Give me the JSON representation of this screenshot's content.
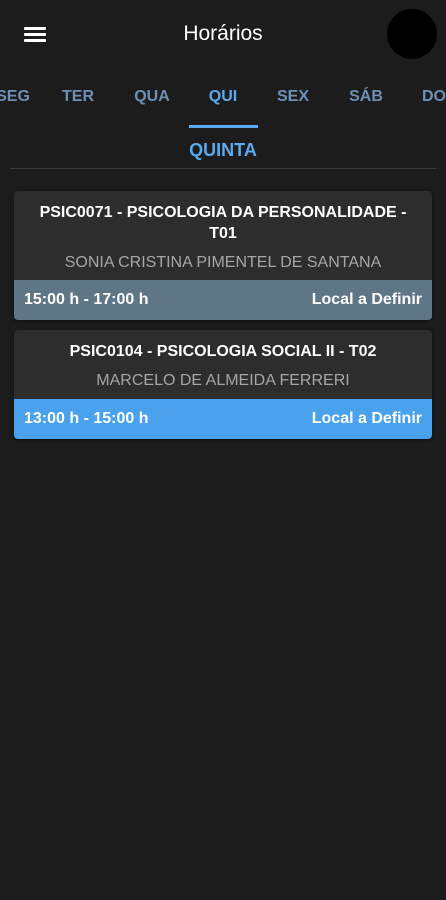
{
  "header": {
    "title": "Horários",
    "menu_icon": "hamburger-menu-icon"
  },
  "tabs": [
    {
      "label": "SEG",
      "active": false
    },
    {
      "label": "TER",
      "active": false
    },
    {
      "label": "QUA",
      "active": false
    },
    {
      "label": "QUI",
      "active": true
    },
    {
      "label": "SEX",
      "active": false
    },
    {
      "label": "SÁB",
      "active": false
    },
    {
      "label": "DOM",
      "active": false
    }
  ],
  "day_title": "QUINTA",
  "classes": [
    {
      "title": "PSIC0071 - PSICOLOGIA DA PERSONALIDADE - T01",
      "professor": "SONIA CRISTINA PIMENTEL DE SANTANA",
      "time": "15:00 h - 17:00 h",
      "location": "Local a Definir",
      "footer_color": "#5f7687"
    },
    {
      "title": "PSIC0104 - PSICOLOGIA SOCIAL II - T02",
      "professor": "MARCELO DE ALMEIDA FERRERI",
      "time": "13:00 h - 15:00 h",
      "location": "Local a Definir",
      "footer_color": "#4aa2ec"
    }
  ],
  "colors": {
    "background": "#1c1c1c",
    "accent": "#5aaaf2",
    "tab_inactive": "#6e90b6",
    "card": "#2d2d2d"
  }
}
